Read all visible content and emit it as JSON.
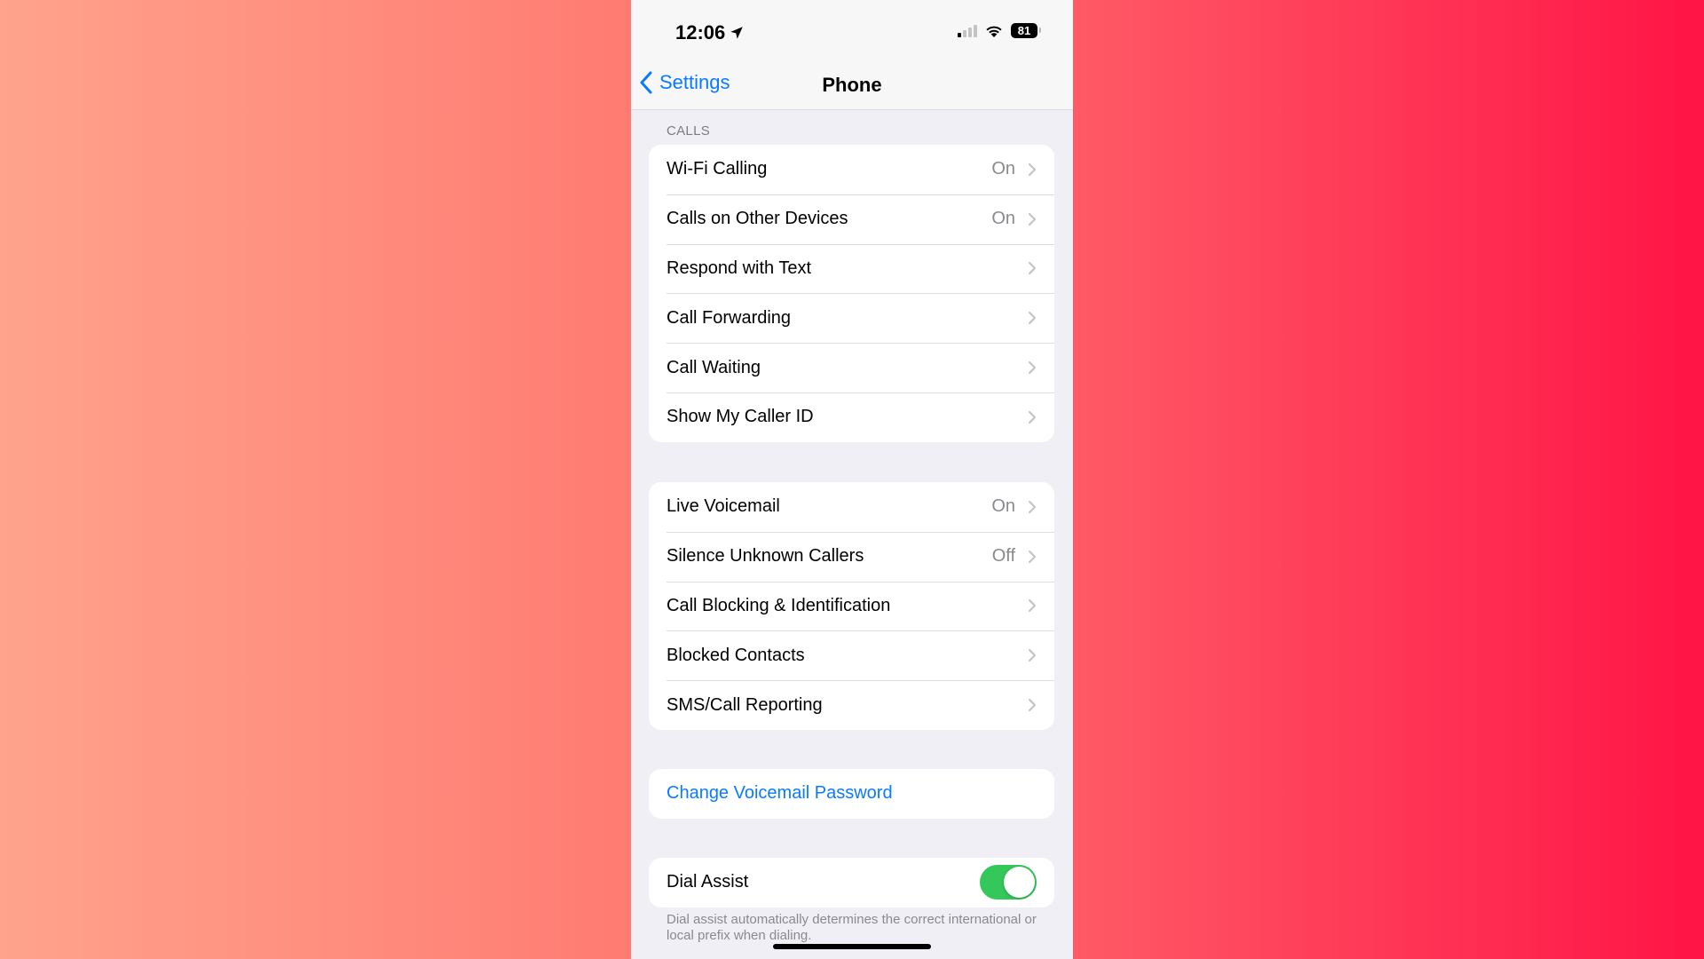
{
  "status_bar": {
    "time": "12:06",
    "location_icon": "location-arrow-icon",
    "signal_bars_active": 1,
    "signal_bars_total": 4,
    "wifi_icon": "wifi-icon",
    "battery_percent": "81"
  },
  "nav": {
    "back_label": "Settings",
    "title": "Phone"
  },
  "sections": {
    "calls_header": "CALLS",
    "calls": [
      {
        "label": "Wi-Fi Calling",
        "value": "On"
      },
      {
        "label": "Calls on Other Devices",
        "value": "On"
      },
      {
        "label": "Respond with Text",
        "value": ""
      },
      {
        "label": "Call Forwarding",
        "value": ""
      },
      {
        "label": "Call Waiting",
        "value": ""
      },
      {
        "label": "Show My Caller ID",
        "value": ""
      }
    ],
    "voicemail": [
      {
        "label": "Live Voicemail",
        "value": "On"
      },
      {
        "label": "Silence Unknown Callers",
        "value": "Off"
      },
      {
        "label": "Call Blocking & Identification",
        "value": ""
      },
      {
        "label": "Blocked Contacts",
        "value": ""
      },
      {
        "label": "SMS/Call Reporting",
        "value": ""
      }
    ],
    "change_voicemail_password": "Change Voicemail Password",
    "dial_assist": {
      "label": "Dial Assist",
      "enabled": true,
      "footnote": "Dial assist automatically determines the correct international or local prefix when dialing."
    }
  },
  "colors": {
    "accent": "#0a7aff",
    "toggle_on": "#34c759",
    "background_gradient_start": "#ffa38c",
    "background_gradient_end": "#ff1446"
  }
}
